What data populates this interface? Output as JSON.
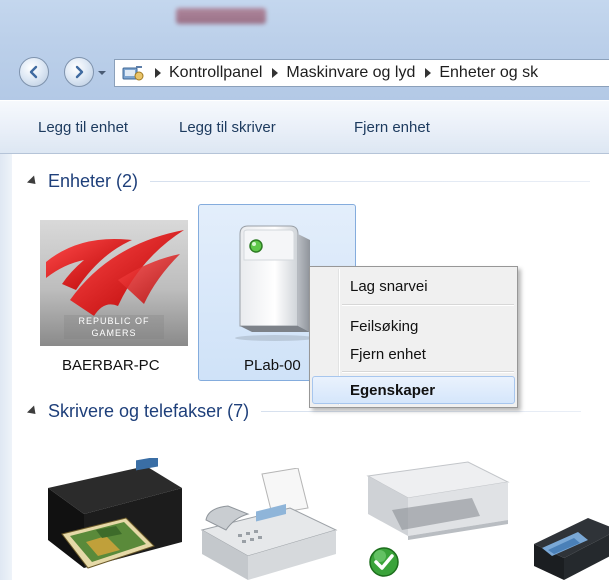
{
  "address_bar": {
    "breadcrumbs": [
      "Kontrollpanel",
      "Maskinvare og lyd",
      "Enheter og sk"
    ]
  },
  "toolbar": {
    "add_device": "Legg til enhet",
    "add_printer": "Legg til skriver",
    "remove_device": "Fjern enhet"
  },
  "groups": {
    "devices": {
      "header": "Enheter (2)",
      "items": [
        {
          "label": "BAERBAR-PC",
          "logo_text": [
            "REPUBLIC OF",
            "GAMERS"
          ],
          "icon": "rog-laptop-icon"
        },
        {
          "label": "PLab-00",
          "icon": "server-tower-icon",
          "selected": true
        }
      ]
    },
    "printers": {
      "header": "Skrivere og telefakser (7)",
      "items": [
        {
          "icon": "inkjet-printer-icon"
        },
        {
          "icon": "fax-machine-icon"
        },
        {
          "icon": "scanner-printer-icon",
          "default": true
        },
        {
          "icon": "photo-printer-icon"
        }
      ]
    }
  },
  "context_menu": {
    "items": [
      "Lag snarvei",
      "Feilsøking",
      "Fjern enhet",
      "Egenskaper"
    ],
    "highlighted": "Egenskaper"
  },
  "colors": {
    "group_header": "#1e3f7a",
    "command_text": "#1c3a5e",
    "selection": "#cfe2f8",
    "default_check": "#3aa33a"
  }
}
